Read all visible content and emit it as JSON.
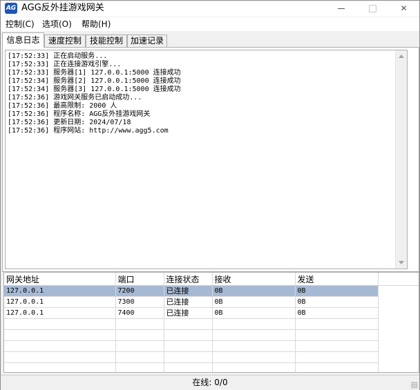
{
  "window": {
    "title": "AGG反外挂游戏网关",
    "icon_text": "AG",
    "icon": "app-logo-icon",
    "accent_color": "#1c56b6"
  },
  "menu": {
    "items": [
      {
        "label": "控制(C)"
      },
      {
        "label": "选项(O)"
      },
      {
        "label": "帮助(H)"
      }
    ]
  },
  "tabs": [
    {
      "label": "信息日志",
      "active": true
    },
    {
      "label": "速度控制",
      "active": false
    },
    {
      "label": "技能控制",
      "active": false
    },
    {
      "label": "加速记录",
      "active": false
    }
  ],
  "log": {
    "lines": [
      "[17:52:33] 正在启动服务...",
      "[17:52:33] 正在连接游戏引擎...",
      "[17:52:33] 服务器[1] 127.0.0.1:5000 连接成功",
      "[17:52:34] 服务器[2] 127.0.0.1:5000 连接成功",
      "[17:52:34] 服务器[3] 127.0.0.1:5000 连接成功",
      "[17:52:36] 游戏网关服务已启动成功...",
      "[17:52:36] 最高限制: 2000 人",
      "[17:52:36] 程序名称: AGG反外挂游戏网关",
      "[17:52:36] 更新日期: 2024/07/18",
      "[17:52:36] 程序网站: http://www.agg5.com"
    ]
  },
  "table": {
    "columns": [
      "网关地址",
      "端口",
      "连接状态",
      "接收",
      "发送"
    ],
    "rows": [
      {
        "address": "127.0.0.1",
        "port": "7200",
        "status": "已连接",
        "recv": "0B",
        "send": "0B",
        "selected": true
      },
      {
        "address": "127.0.0.1",
        "port": "7300",
        "status": "已连接",
        "recv": "0B",
        "send": "0B",
        "selected": false
      },
      {
        "address": "127.0.0.1",
        "port": "7400",
        "status": "已连接",
        "recv": "0B",
        "send": "0B",
        "selected": false
      }
    ],
    "selected_color": "#a6b9d4"
  },
  "status": {
    "text": "在线: 0/0"
  }
}
